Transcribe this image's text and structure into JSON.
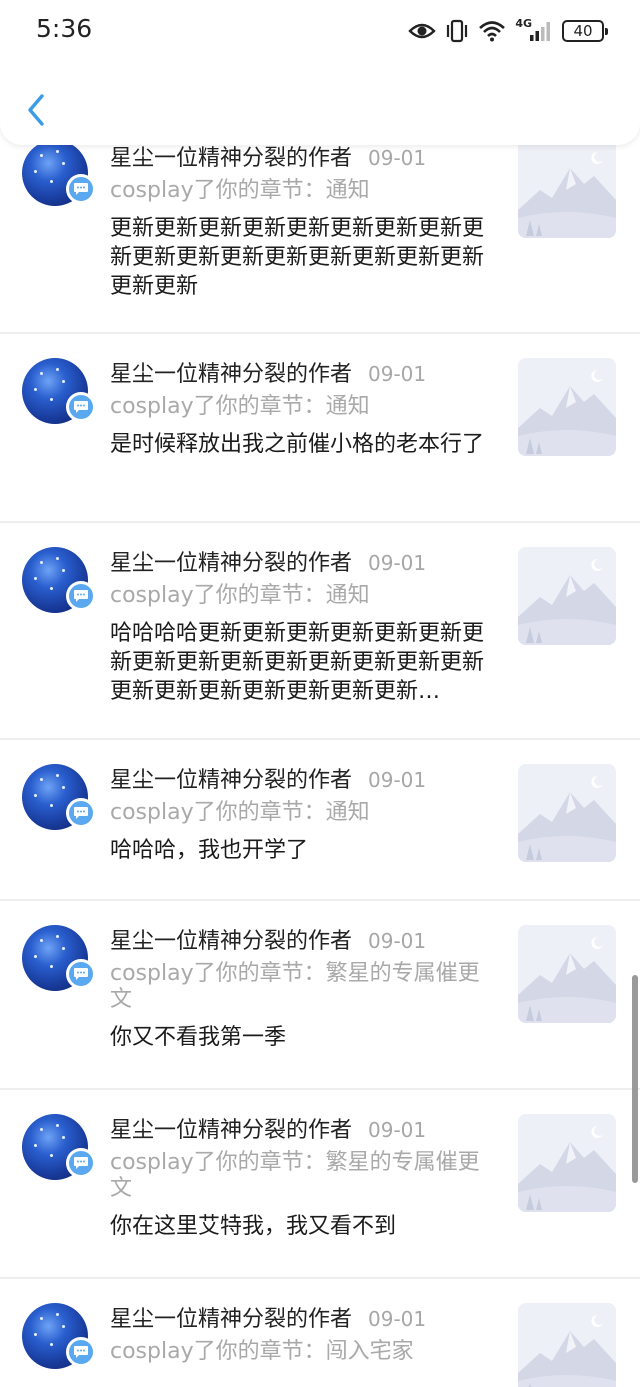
{
  "status_bar": {
    "time": "5:36",
    "network_label": "4G",
    "battery_level": "40",
    "icons": [
      "eye-icon",
      "vibrate-icon",
      "wifi-icon",
      "signal-icon",
      "battery-icon"
    ]
  },
  "header": {
    "back_icon": "chevron-left-icon"
  },
  "colors": {
    "accent": "#3a9be8",
    "badge": "#5aa8f0",
    "divider": "#eeeeee",
    "muted_text": "#a9a9a9"
  },
  "notifications": [
    {
      "author": "星尘一位精神分裂的作者",
      "date": "09-01",
      "subtitle": "cosplay了你的章节：通知",
      "content": "更新更新更新更新更新更新更新更新更新更新更新更新更新更新更新更新更新更新更新"
    },
    {
      "author": "星尘一位精神分裂的作者",
      "date": "09-01",
      "subtitle": "cosplay了你的章节：通知",
      "content": "是时候释放出我之前催小格的老本行了"
    },
    {
      "author": "星尘一位精神分裂的作者",
      "date": "09-01",
      "subtitle": "cosplay了你的章节：通知",
      "content": "哈哈哈哈更新更新更新更新更新更新更新更新更新更新更新更新更新更新更新更新更新更新更新更新更新更新…"
    },
    {
      "author": "星尘一位精神分裂的作者",
      "date": "09-01",
      "subtitle": "cosplay了你的章节：通知",
      "content": "哈哈哈，我也开学了"
    },
    {
      "author": "星尘一位精神分裂的作者",
      "date": "09-01",
      "subtitle": "cosplay了你的章节：繁星的专属催更文",
      "content": "你又不看我第一季"
    },
    {
      "author": "星尘一位精神分裂的作者",
      "date": "09-01",
      "subtitle": "cosplay了你的章节：繁星的专属催更文",
      "content": "你在这里艾特我，我又看不到"
    },
    {
      "author": "星尘一位精神分裂的作者",
      "date": "09-01",
      "subtitle": "cosplay了你的章节：闯入宅家",
      "content": ""
    }
  ]
}
